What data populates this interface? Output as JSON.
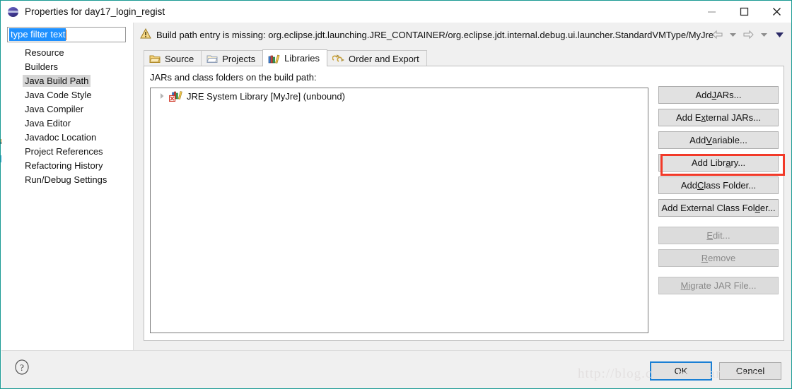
{
  "window": {
    "title": "Properties for day17_login_regist",
    "app_icon": "eclipse-globe-icon",
    "minimize_label": "Minimize",
    "maximize_label": "Maximize",
    "close_label": "Close"
  },
  "sidebar": {
    "filter": {
      "value": "type filter text",
      "placeholder": "type filter text",
      "selected": true
    },
    "items": [
      {
        "label": "Resource",
        "selected": false
      },
      {
        "label": "Builders",
        "selected": false
      },
      {
        "label": "Java Build Path",
        "selected": true
      },
      {
        "label": "Java Code Style",
        "selected": false
      },
      {
        "label": "Java Compiler",
        "selected": false
      },
      {
        "label": "Java Editor",
        "selected": false
      },
      {
        "label": "Javadoc Location",
        "selected": false
      },
      {
        "label": "Project References",
        "selected": false
      },
      {
        "label": "Refactoring History",
        "selected": false
      },
      {
        "label": "Run/Debug Settings",
        "selected": false
      }
    ]
  },
  "message": {
    "icon": "warning-icon",
    "text": "Build path entry is missing: org.eclipse.jdt.launching.JRE_CONTAINER/org.eclipse.jdt.internal.debug.ui.launcher.StandardVMType/MyJre"
  },
  "nav": {
    "back_label": "Back",
    "back_menu_label": "Back history",
    "forward_label": "Forward",
    "forward_menu_label": "Forward history",
    "menu_label": "View menu"
  },
  "tabs": [
    {
      "label": "Source",
      "icon": "source-folder-icon",
      "active": false
    },
    {
      "label": "Projects",
      "icon": "projects-folder-icon",
      "active": false
    },
    {
      "label": "Libraries",
      "icon": "libraries-books-icon",
      "active": true
    },
    {
      "label": "Order and Export",
      "icon": "order-export-icon",
      "active": false
    }
  ],
  "content": {
    "list_label": "JARs and class folders on the build path:",
    "list_label_mnemonic": "t",
    "entries": [
      {
        "label": "JRE System Library [MyJre] (unbound)",
        "icon": "jre-library-error-icon",
        "expanded": false
      }
    ]
  },
  "buttons": [
    {
      "pre": "Add ",
      "mn": "J",
      "post": "ARs...",
      "enabled": true,
      "name": "add-jars-button"
    },
    {
      "pre": "Add E",
      "mn": "x",
      "post": "ternal JARs...",
      "enabled": true,
      "name": "add-external-jars-button"
    },
    {
      "pre": "Add ",
      "mn": "V",
      "post": "ariable...",
      "enabled": true,
      "name": "add-variable-button"
    },
    {
      "pre": "Add Libr",
      "mn": "a",
      "post": "ry...",
      "enabled": true,
      "name": "add-library-button",
      "highlighted": true
    },
    {
      "pre": "Add ",
      "mn": "C",
      "post": "lass Folder...",
      "enabled": true,
      "name": "add-class-folder-button"
    },
    {
      "pre": "Add External Class Fol",
      "mn": "d",
      "post": "er...",
      "enabled": true,
      "name": "add-external-class-folder-button"
    },
    {
      "pre": "",
      "mn": "E",
      "post": "dit...",
      "enabled": false,
      "name": "edit-button",
      "spaced": true
    },
    {
      "pre": "",
      "mn": "R",
      "post": "emove",
      "enabled": false,
      "name": "remove-button"
    },
    {
      "pre": "",
      "mn": "Mi",
      "post": "grate JAR File...",
      "enabled": false,
      "name": "migrate-jar-file-button",
      "spaced": true
    }
  ],
  "footer": {
    "help_label": "Help",
    "ok_label": "OK",
    "cancel_label": "Cancel",
    "watermark": "http://blog.csdn.net/YanLeaon"
  },
  "colors": {
    "window_border": "#1a9a94",
    "selection_blue": "#1e90ff",
    "highlight_red": "#f23a29",
    "default_button_blue": "#1a7fd4"
  }
}
